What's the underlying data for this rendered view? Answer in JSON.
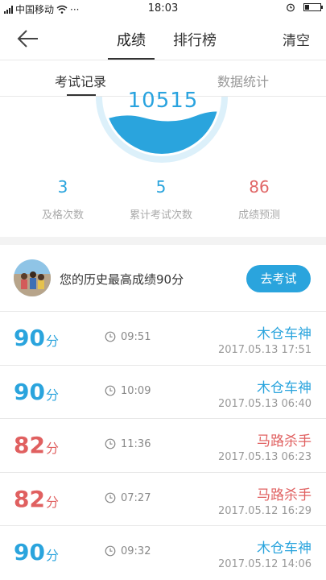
{
  "status_bar": {
    "carrier": "中国移动",
    "dots": "···",
    "time": "18:03"
  },
  "nav": {
    "tabs": [
      "成绩",
      "排行榜"
    ],
    "active_tab": 0,
    "clear_label": "清空"
  },
  "sub_tabs": {
    "items": [
      "考试记录",
      "数据统计"
    ],
    "active": 0
  },
  "gauge": {
    "score": "10515",
    "fill_level": 0.5
  },
  "stats": [
    {
      "value": "3",
      "label": "及格次数"
    },
    {
      "value": "5",
      "label": "累计考试次数"
    },
    {
      "value": "86",
      "label": "成绩预测"
    }
  ],
  "best": {
    "text": "您的历史最高成绩90分",
    "button": "去考试"
  },
  "records": [
    {
      "score": "90",
      "unit": "分",
      "duration": "09:51",
      "name": "木仓车神",
      "date": "2017.05.13  17:51",
      "color": "#2aa4dd"
    },
    {
      "score": "90",
      "unit": "分",
      "duration": "10:09",
      "name": "木仓车神",
      "date": "2017.05.13  06:40",
      "color": "#2aa4dd"
    },
    {
      "score": "82",
      "unit": "分",
      "duration": "11:36",
      "name": "马路杀手",
      "date": "2017.05.13  06:23",
      "color": "#e06060"
    },
    {
      "score": "82",
      "unit": "分",
      "duration": "07:27",
      "name": "马路杀手",
      "date": "2017.05.12  16:29",
      "color": "#e06060"
    },
    {
      "score": "90",
      "unit": "分",
      "duration": "09:32",
      "name": "木仓车神",
      "date": "2017.05.12  14:06",
      "color": "#2aa4dd"
    }
  ],
  "icons": {
    "back": "arrow-left-icon",
    "clock": "clock-icon",
    "wifi": "wifi-icon",
    "alarm": "alarm-icon",
    "battery": "battery-icon"
  }
}
